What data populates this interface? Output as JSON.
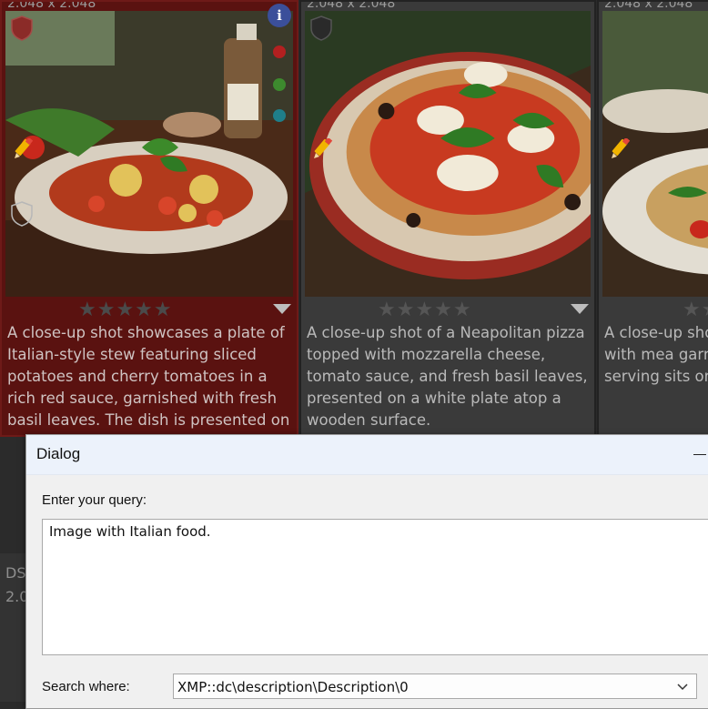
{
  "gallery": {
    "tiles": [
      {
        "dimensions": "2.048 x 2.048",
        "rating_stars": "★★★★★",
        "description": "A close-up shot showcases a plate of Italian-style stew featuring sliced potatoes and cherry tomatoes in a rich red sauce, garnished with fresh basil leaves. The dish is presented on a rustic food sau coo cui",
        "selected": true
      },
      {
        "dimensions": "2.048 x 2.048",
        "rating_stars": "★★★★★",
        "description": "A close-up shot of a Neapolitan pizza topped with mozzarella cheese, tomato sauce, and fresh basil leaves, presented on a white plate atop a wooden surface.",
        "selected": false
      },
      {
        "dimensions": "2.048 x 2.048",
        "rating_stars": "★★",
        "description": "A close-up sho pasta with mea garnished with serving sits on",
        "selected": false
      }
    ],
    "second_row": {
      "name": "DS",
      "dimensions": "2.0"
    },
    "info_icon_label": "i",
    "colors": {
      "selected_tile": "#5a1210",
      "tile": "#3a3a3a",
      "label_red": "#b32020",
      "label_green": "#3d8a2e",
      "label_teal": "#1f7f8a"
    }
  },
  "dialog": {
    "title": "Dialog",
    "query_label": "Enter your query:",
    "query_value": "Image with Italian food.",
    "search_where_label": "Search where:",
    "search_where_value": "XMP::dc\\description\\Description\\0"
  }
}
